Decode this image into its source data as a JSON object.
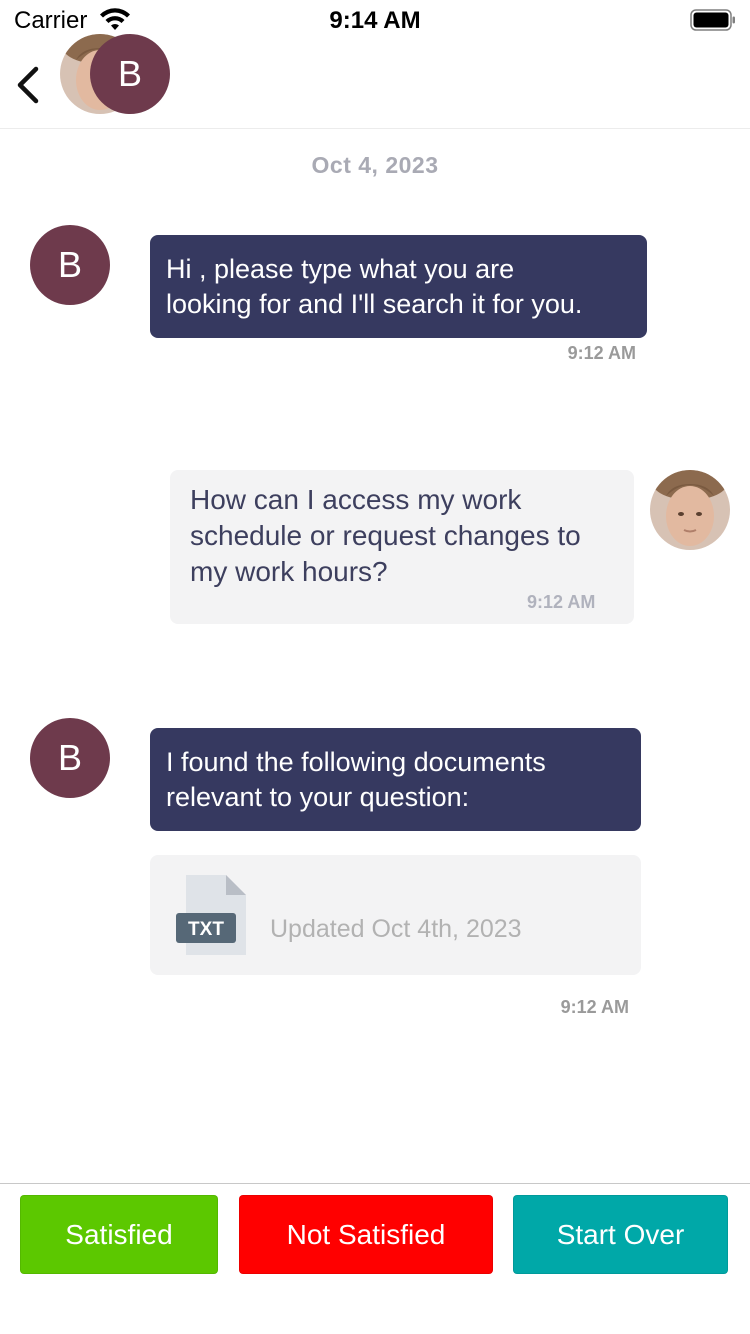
{
  "status_bar": {
    "carrier": "Carrier",
    "time": "9:14 AM"
  },
  "header": {
    "bot_initial": "B",
    "icons": {
      "back": "chevron-left-icon",
      "user_avatar": "user-photo-avatar"
    }
  },
  "chat": {
    "date": "Oct 4, 2023",
    "messages": [
      {
        "sender": "bot",
        "avatar_initial": "B",
        "text_lines": [
          "Hi , please type what you are",
          "looking for and I'll search it for you."
        ],
        "time": "9:12 AM"
      },
      {
        "sender": "user",
        "text_lines": [
          "How can I access my work",
          "schedule or request changes to",
          "my work hours?"
        ],
        "time": "9:12 AM"
      },
      {
        "sender": "bot",
        "avatar_initial": "B",
        "text_lines": [
          "I found the following documents",
          "relevant to your question:"
        ],
        "document": {
          "type_label": "TXT",
          "updated": "Updated Oct 4th, 2023"
        },
        "time": "9:12 AM"
      }
    ]
  },
  "footer": {
    "buttons": [
      {
        "label": "Satisfied",
        "color": "#5cc800"
      },
      {
        "label": "Not Satisfied",
        "color": "#ff0000"
      },
      {
        "label": "Start Over",
        "color": "#00a8a8"
      }
    ]
  },
  "colors": {
    "bot_bubble": "#363960",
    "bot_avatar": "#6e3a4c",
    "user_bubble": "#f3f3f4"
  }
}
